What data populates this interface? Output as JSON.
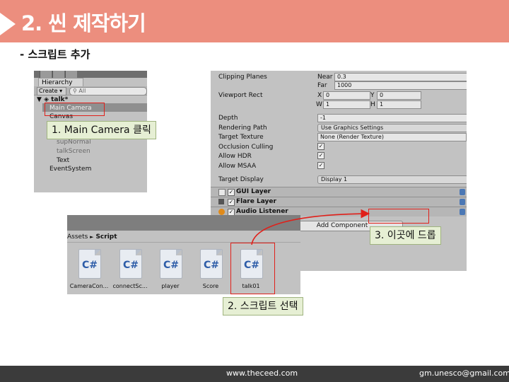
{
  "slide": {
    "title": "2. 씬 제작하기",
    "subtitle": "- 스크립트 추가",
    "footer": {
      "website": "www.theceed.com",
      "email": "gm.unesco@gmail.com"
    }
  },
  "hierarchy": {
    "tab": "Hierarchy",
    "create_label": "Create ▾",
    "search_placeholder": "All",
    "scene": "talk*",
    "items": [
      {
        "label": "Main Camera",
        "selected": true
      },
      {
        "label": "Canvas"
      },
      {
        "label": "supNormal"
      },
      {
        "label": "talkScreen"
      },
      {
        "label": "Text"
      },
      {
        "label": "EventSystem"
      }
    ]
  },
  "inspector": {
    "clipping_planes": {
      "label": "Clipping Planes",
      "near_label": "Near",
      "near": "0.3",
      "far_label": "Far",
      "far": "1000"
    },
    "viewport_rect": {
      "label": "Viewport Rect",
      "x_label": "X",
      "x": "0",
      "y_label": "Y",
      "y": "0",
      "w_label": "W",
      "w": "1",
      "h_label": "H",
      "h": "1"
    },
    "depth": {
      "label": "Depth",
      "value": "-1"
    },
    "rendering_path": {
      "label": "Rendering Path",
      "value": "Use Graphics Settings"
    },
    "target_texture": {
      "label": "Target Texture",
      "value": "None (Render Texture)"
    },
    "occlusion_culling": {
      "label": "Occlusion Culling",
      "checked": true
    },
    "allow_hdr": {
      "label": "Allow HDR",
      "checked": true
    },
    "allow_msaa": {
      "label": "Allow MSAA",
      "checked": true
    },
    "target_display": {
      "label": "Target Display",
      "value": "Display 1"
    },
    "components": [
      "GUI Layer",
      "Flare Layer",
      "Audio Listener"
    ],
    "add_component": "Add Component",
    "check_mark": "✓"
  },
  "project": {
    "breadcrumb_root": "Assets",
    "breadcrumb_sep": "►",
    "breadcrumb_folder": "Script",
    "files": [
      "CameraCon...",
      "connectSc...",
      "player",
      "Score",
      "talk01"
    ],
    "file_icon_text": "C#"
  },
  "callouts": {
    "step1": "1. Main Camera 클릭",
    "step2": "2. 스크립트 선택",
    "step3": "3. 이곳에 드롭"
  },
  "colors": {
    "header": "#ec8e7e",
    "callout_bg": "#e6efd4",
    "highlight_red": "#e0201a"
  }
}
